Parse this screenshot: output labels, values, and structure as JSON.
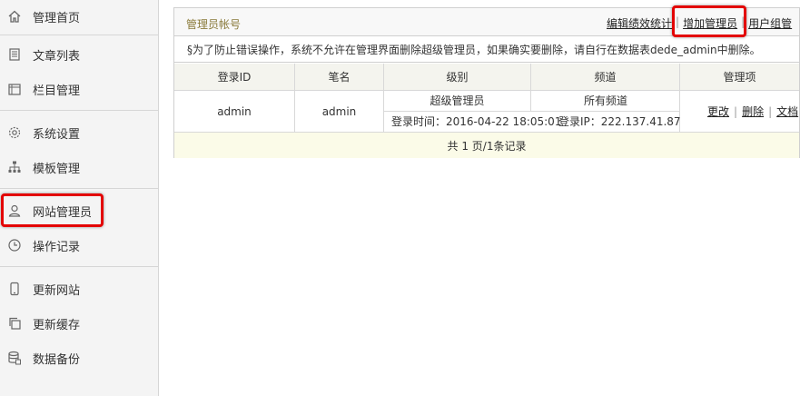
{
  "sidebar": {
    "items": [
      {
        "label": "管理首页",
        "icon": "home-icon"
      },
      {
        "label": "文章列表",
        "icon": "document-icon"
      },
      {
        "label": "栏目管理",
        "icon": "folder-icon"
      },
      {
        "label": "系统设置",
        "icon": "gear-icon"
      },
      {
        "label": "模板管理",
        "icon": "sitemap-icon"
      },
      {
        "label": "网站管理员",
        "icon": "user-icon"
      },
      {
        "label": "操作记录",
        "icon": "clock-icon"
      },
      {
        "label": "更新网站",
        "icon": "mobile-icon"
      },
      {
        "label": "更新缓存",
        "icon": "copy-icon"
      },
      {
        "label": "数据备份",
        "icon": "database-icon"
      }
    ]
  },
  "panel": {
    "title": "管理员帐号",
    "links": [
      "编辑绩效统计",
      "增加管理员",
      "用户组管"
    ],
    "notice": "§为了防止错误操作，系统不允许在管理界面删除超级管理员，如果确实要删除，请自行在数据表dede_admin中删除。",
    "table": {
      "headers": [
        "登录ID",
        "笔名",
        "级别",
        "频道",
        "管理项"
      ],
      "rows": [
        {
          "login_id": "admin",
          "pen_name": "admin",
          "level": "超级管理员",
          "channel": "所有频道",
          "login_time": "登录时间：2016-04-22 18:05:01",
          "login_ip": "登录IP：222.137.41.87",
          "actions": [
            "更改",
            "删除",
            "文档"
          ]
        }
      ],
      "footer": "共 1 页/1条记录"
    }
  },
  "colors": {
    "highlight": "#e30000",
    "title": "#8a7a3a",
    "footer_bg": "#fbfbe8",
    "header_bg": "#f4f4ee"
  }
}
